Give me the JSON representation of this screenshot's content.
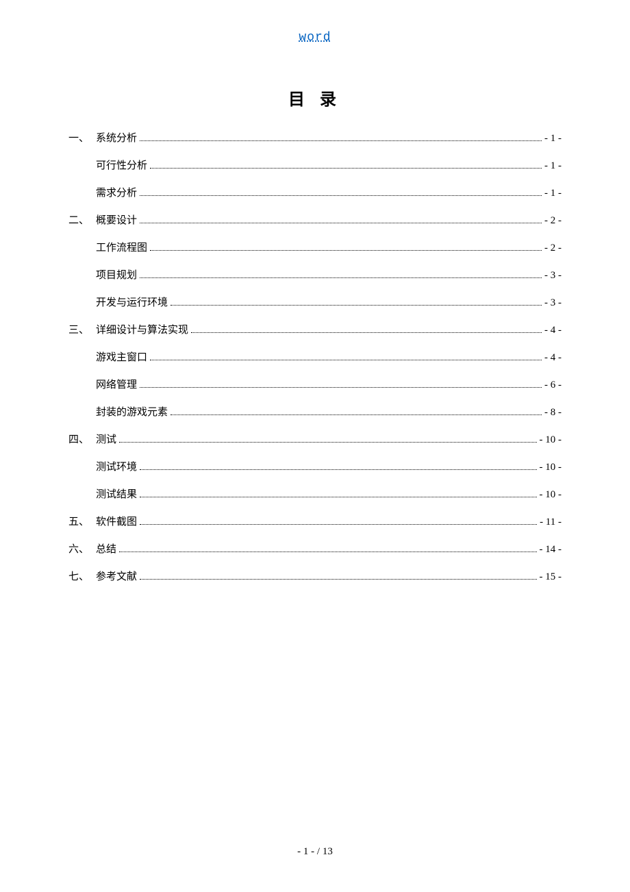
{
  "header": {
    "link_text": "word"
  },
  "toc": {
    "title": "目 录",
    "entries": [
      {
        "level": 1,
        "number": "一、",
        "label": "系统分析",
        "page": "- 1 -"
      },
      {
        "level": 2,
        "number": "",
        "label": "可行性分析",
        "page": "- 1 -"
      },
      {
        "level": 2,
        "number": "",
        "label": "需求分析",
        "page": "- 1 -"
      },
      {
        "level": 1,
        "number": "二、",
        "label": "概要设计",
        "page": "- 2 -"
      },
      {
        "level": 2,
        "number": "",
        "label": "工作流程图",
        "page": "- 2 -"
      },
      {
        "level": 2,
        "number": "",
        "label": "项目规划",
        "page": "- 3 -"
      },
      {
        "level": 2,
        "number": "",
        "label": "开发与运行环境",
        "page": "- 3 -"
      },
      {
        "level": 1,
        "number": "三、",
        "label": "详细设计与算法实现",
        "page": "- 4 -"
      },
      {
        "level": 2,
        "number": "",
        "label": "游戏主窗口",
        "page": "- 4 -"
      },
      {
        "level": 2,
        "number": "",
        "label": "网络管理",
        "page": "- 6 -"
      },
      {
        "level": 2,
        "number": "",
        "label": "封装的游戏元素",
        "page": "- 8 -"
      },
      {
        "level": 1,
        "number": "四、",
        "label": "测试",
        "page": "- 10 -"
      },
      {
        "level": 2,
        "number": "",
        "label": "测试环境",
        "page": "- 10 -"
      },
      {
        "level": 2,
        "number": "",
        "label": "测试结果",
        "page": "- 10 -"
      },
      {
        "level": 1,
        "number": "五、",
        "label": "软件截图",
        "page": "- 11 -"
      },
      {
        "level": 1,
        "number": "六、",
        "label": "总结",
        "page": "- 14 -"
      },
      {
        "level": 1,
        "number": "七、",
        "label": "参考文献",
        "page": "- 15 -"
      }
    ]
  },
  "footer": {
    "page_indicator": "- 1 -  / 13"
  }
}
